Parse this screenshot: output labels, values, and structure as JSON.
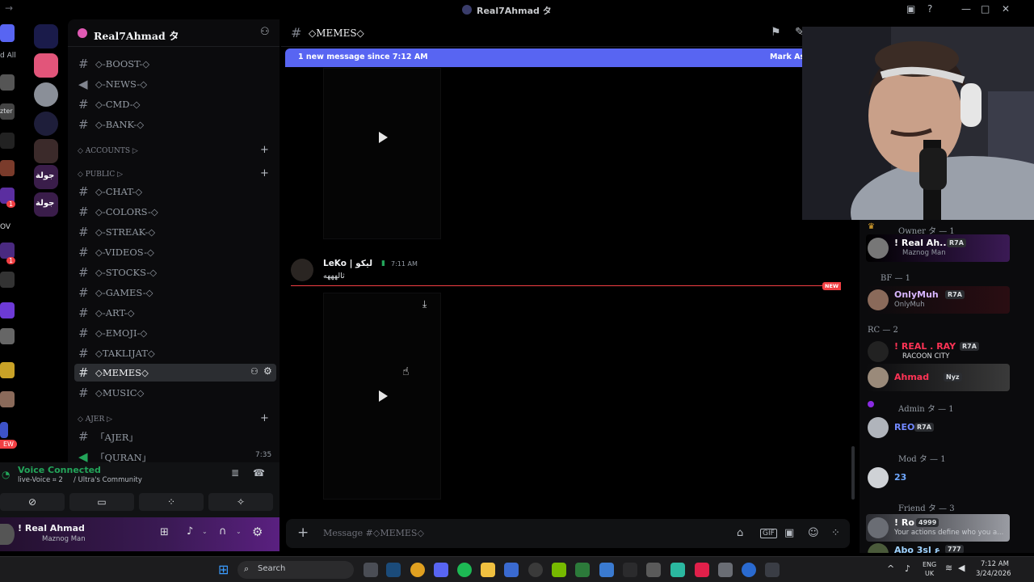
{
  "window": {
    "title": "Real7Ahmad タ"
  },
  "server": {
    "name": "Real7Ahmad タ"
  },
  "rail": {
    "partial_labels": [
      "d All",
      "zter",
      "OV",
      "EW"
    ],
    "guild_labels": [
      "جولة",
      "جولة"
    ],
    "badges": [
      "1",
      "1"
    ]
  },
  "channels": [
    {
      "name": "◇-BOOST-◇"
    },
    {
      "name": "◇-NEWS-◇"
    },
    {
      "name": "◇-CMD-◇"
    },
    {
      "name": "◇-BANK-◇"
    }
  ],
  "categories": {
    "accounts": "◇ ACCOUNTS ▷",
    "public": "◇ PUBLIC ▷",
    "ajer": "◇ AJER ▷"
  },
  "public_channels": [
    {
      "name": "◇-CHAT-◇"
    },
    {
      "name": "◇-COLORS-◇"
    },
    {
      "name": "◇-STREAK-◇"
    },
    {
      "name": "◇-VIDEOS-◇"
    },
    {
      "name": "◇-STOCKS-◇"
    },
    {
      "name": "◇-GAMES-◇"
    },
    {
      "name": "◇-ART-◇"
    },
    {
      "name": "◇-EMOJI-◇"
    },
    {
      "name": "◇TAKLIJAT◇"
    },
    {
      "name": "◇MEMES◇"
    },
    {
      "name": "◇MUSIC◇"
    }
  ],
  "ajer_channels": [
    {
      "name": "「AJER」"
    },
    {
      "name": "「QURAN」",
      "time": "7:35"
    }
  ],
  "voice": {
    "status": "Voice Connected",
    "channel": "live-Voice ⌗ 2",
    "server": "/ Ultra's Community"
  },
  "user": {
    "name": "! Real Ahmad",
    "status": "Maznog Man"
  },
  "chat": {
    "channel_title": "◇MEMES◇",
    "banner_text": "1 new message since 7:12 AM",
    "banner_action": "Mark As",
    "message": {
      "author": "LeKo | ليكو",
      "time": "7:11 AM",
      "text": "ثالهههه",
      "new_label": "NEW"
    },
    "composer_placeholder": "Message #◇MEMES◇"
  },
  "members": {
    "groups": [
      {
        "label": "Owner タ — 1"
      },
      {
        "label": "BF — 1"
      },
      {
        "label": "RC — 2"
      },
      {
        "label": "Admin タ — 1"
      },
      {
        "label": "Mod タ — 1"
      },
      {
        "label": "Friend タ — 3"
      }
    ],
    "items": [
      {
        "name": "! Real Ah...",
        "tag": "R7A",
        "status": "Maznog Man",
        "color": "#ffffff"
      },
      {
        "name": "OnlyMuh",
        "tag": "R7A",
        "status": "OnlyMuh",
        "color": "#d8b6ff"
      },
      {
        "name": "! REAL . RAY",
        "tag": "R7A",
        "status": "RACOON CITY",
        "color": "#ff3355"
      },
      {
        "name": "Ahmad",
        "tag": "Nyz",
        "status": "",
        "color": "#ff3355"
      },
      {
        "name": "REO",
        "tag": "R7A",
        "status": "",
        "color": "#7289ff"
      },
      {
        "name": "23",
        "tag": "",
        "status": "",
        "color": "#6fa8ff"
      },
      {
        "name": "! Ro",
        "tag": "4999",
        "status": "Your actions define who you a...",
        "color": "#ffffff"
      },
      {
        "name": "Abo 3sl ع",
        "tag": "777",
        "status": "",
        "color": "#9fd3ff"
      }
    ]
  },
  "taskbar": {
    "search": "Search",
    "lang": "ENG",
    "region": "UK",
    "time": "7:12 AM",
    "date": "3/24/2026"
  },
  "colors": {
    "accent": "#5865f2",
    "new_red": "#f23f43",
    "voice_green": "#23a55a"
  }
}
